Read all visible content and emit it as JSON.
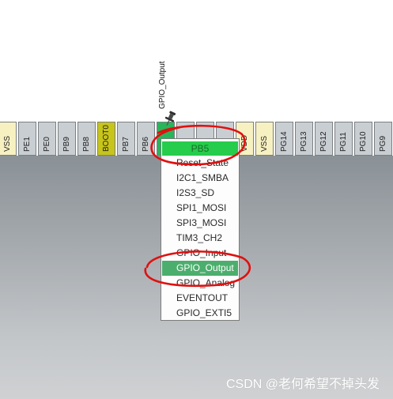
{
  "pins": [
    {
      "label": "VSS",
      "type": "power"
    },
    {
      "label": "PE1",
      "type": "gpio"
    },
    {
      "label": "PE0",
      "type": "gpio"
    },
    {
      "label": "PB9",
      "type": "gpio"
    },
    {
      "label": "PB8",
      "type": "gpio"
    },
    {
      "label": "BOOT0",
      "type": "boot"
    },
    {
      "label": "PB7",
      "type": "gpio"
    },
    {
      "label": "PB6",
      "type": "gpio"
    },
    {
      "label": "",
      "type": "active"
    },
    {
      "label": "",
      "type": "gpio"
    },
    {
      "label": "",
      "type": "gpio"
    },
    {
      "label": "",
      "type": "gpio"
    },
    {
      "label": "VDD",
      "type": "power"
    },
    {
      "label": "VSS",
      "type": "power"
    },
    {
      "label": "PG14",
      "type": "gpio"
    },
    {
      "label": "PG13",
      "type": "gpio"
    },
    {
      "label": "PG12",
      "type": "gpio"
    },
    {
      "label": "PG11",
      "type": "gpio"
    },
    {
      "label": "PG10",
      "type": "gpio"
    },
    {
      "label": "PG9",
      "type": "gpio"
    }
  ],
  "pin_assignment_label": "GPIO_Output",
  "pin_menu": {
    "header": "PB5",
    "items": [
      "Reset_State",
      "I2C1_SMBA",
      "I2S3_SD",
      "SPI1_MOSI",
      "SPI3_MOSI",
      "TIM3_CH2",
      "GPIO_Input",
      "GPIO_Output",
      "GPIO_Analog",
      "EVENTOUT",
      "GPIO_EXTI5"
    ],
    "selected": "GPIO_Output"
  },
  "watermark": "CSDN @老何希望不掉头发",
  "colors": {
    "active_pin": "#27b65a",
    "power_pin": "#f7f1c2",
    "boot_pin": "#c7c41a",
    "menu_header": "#26cc4c",
    "menu_selected": "#4cae6d",
    "annotation": "#e01010"
  }
}
